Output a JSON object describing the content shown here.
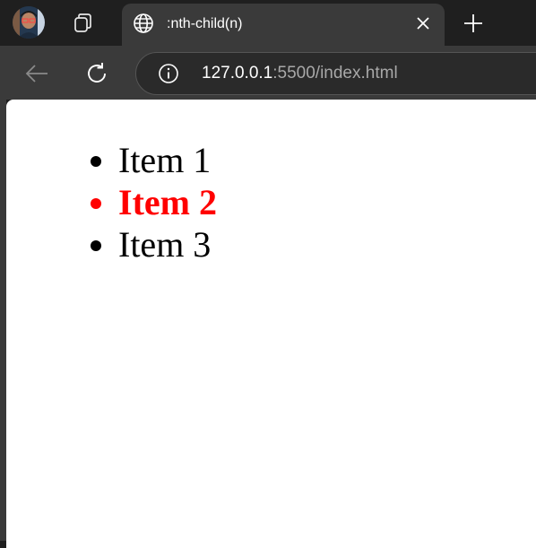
{
  "browser": {
    "active_tab": {
      "title": ":nth-child(n)"
    },
    "address": {
      "host": "127.0.0.1",
      "rest": ":5500/index.html"
    },
    "icons": {
      "profile": "avatar",
      "workspaces": "tab-actions-icon",
      "tab": "globe-icon",
      "close": "close-icon",
      "new_tab": "plus-icon",
      "back": "back-arrow-icon",
      "reload": "refresh-icon",
      "site_info": "info-icon"
    }
  },
  "page": {
    "items": [
      {
        "label": "Item 1"
      },
      {
        "label": "Item 2"
      },
      {
        "label": "Item 3"
      }
    ],
    "highlight_color": "#ff0000"
  }
}
